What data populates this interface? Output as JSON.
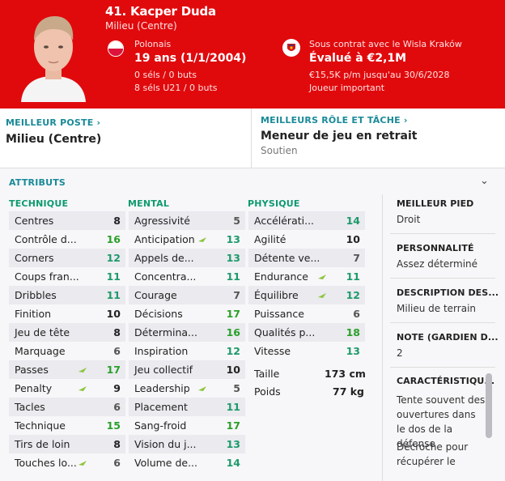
{
  "player": {
    "name": "41. Kacper Duda",
    "position": "Milieu (Centre)",
    "nationality": "Polonais",
    "age": "19 ans (1/1/2004)",
    "selections": "0 séls / 0 buts",
    "u21": "8 séls U21 / 0 buts",
    "contract": "Sous contrat avec le Wisla Kraków",
    "value": "Évalué à €2,1M",
    "wage": "€15,5K p/m jusqu'au 30/6/2028",
    "status": "Joueur important"
  },
  "roles": {
    "best_position_link": "MEILLEUR POSTE",
    "best_position": "Milieu (Centre)",
    "best_role_link": "MEILLEURS RÔLE ET TÂCHE",
    "best_role": "Meneur de jeu en retrait",
    "best_role_duty": "Soutien"
  },
  "attributes": {
    "title": "ATTRIBUTS",
    "technique_head": "TECHNIQUE",
    "mental_head": "MENTAL",
    "physique_head": "PHYSIQUE",
    "technique": [
      {
        "name": "Centres",
        "value": "8",
        "up": false
      },
      {
        "name": "Contrôle d...",
        "value": "16",
        "up": false
      },
      {
        "name": "Corners",
        "value": "12",
        "up": false
      },
      {
        "name": "Coups fran...",
        "value": "11",
        "up": false
      },
      {
        "name": "Dribbles",
        "value": "11",
        "up": false
      },
      {
        "name": "Finition",
        "value": "10",
        "up": false
      },
      {
        "name": "Jeu de tête",
        "value": "8",
        "up": false
      },
      {
        "name": "Marquage",
        "value": "6",
        "up": false
      },
      {
        "name": "Passes",
        "value": "17",
        "up": true
      },
      {
        "name": "Penalty",
        "value": "9",
        "up": true
      },
      {
        "name": "Tacles",
        "value": "6",
        "up": false
      },
      {
        "name": "Technique",
        "value": "15",
        "up": false
      },
      {
        "name": "Tirs de loin",
        "value": "8",
        "up": false
      },
      {
        "name": "Touches lo...",
        "value": "6",
        "up": true
      }
    ],
    "mental": [
      {
        "name": "Agressivité",
        "value": "5",
        "up": false
      },
      {
        "name": "Anticipation",
        "value": "13",
        "up": true
      },
      {
        "name": "Appels de...",
        "value": "13",
        "up": false
      },
      {
        "name": "Concentra...",
        "value": "11",
        "up": false
      },
      {
        "name": "Courage",
        "value": "7",
        "up": false
      },
      {
        "name": "Décisions",
        "value": "17",
        "up": false
      },
      {
        "name": "Détermina...",
        "value": "16",
        "up": false
      },
      {
        "name": "Inspiration",
        "value": "12",
        "up": false
      },
      {
        "name": "Jeu collectif",
        "value": "10",
        "up": false
      },
      {
        "name": "Leadership",
        "value": "5",
        "up": true
      },
      {
        "name": "Placement",
        "value": "11",
        "up": false
      },
      {
        "name": "Sang-froid",
        "value": "17",
        "up": false
      },
      {
        "name": "Vision du j...",
        "value": "13",
        "up": false
      },
      {
        "name": "Volume de...",
        "value": "14",
        "up": false
      }
    ],
    "physique": [
      {
        "name": "Accélérati...",
        "value": "14",
        "up": false
      },
      {
        "name": "Agilité",
        "value": "10",
        "up": false
      },
      {
        "name": "Détente ve...",
        "value": "7",
        "up": false
      },
      {
        "name": "Endurance",
        "value": "11",
        "up": true
      },
      {
        "name": "Équilibre",
        "value": "12",
        "up": true
      },
      {
        "name": "Puissance",
        "value": "6",
        "up": false
      },
      {
        "name": "Qualités p...",
        "value": "18",
        "up": false
      },
      {
        "name": "Vitesse",
        "value": "13",
        "up": false
      }
    ],
    "height_label": "Taille",
    "height": "173 cm",
    "weight_label": "Poids",
    "weight": "77 kg"
  },
  "side": {
    "foot_head": "MEILLEUR PIED",
    "foot": "Droit",
    "personality_head": "PERSONNALITÉ",
    "personality": "Assez déterminé",
    "description_head": "DESCRIPTION DES...",
    "description": "Milieu de terrain",
    "gk_head": "NOTE (GARDIEN D...",
    "gk": "2",
    "traits_head": "CARACTÉRISTIQU...",
    "trait1": "Tente souvent des ouvertures dans le dos de la défense",
    "trait2": "Décroche pour récupérer le"
  },
  "colors": {
    "header": "#e00a0d",
    "accent": "#1a8a98",
    "section": "#0d9a6e",
    "high_value": "#2aa02a"
  }
}
